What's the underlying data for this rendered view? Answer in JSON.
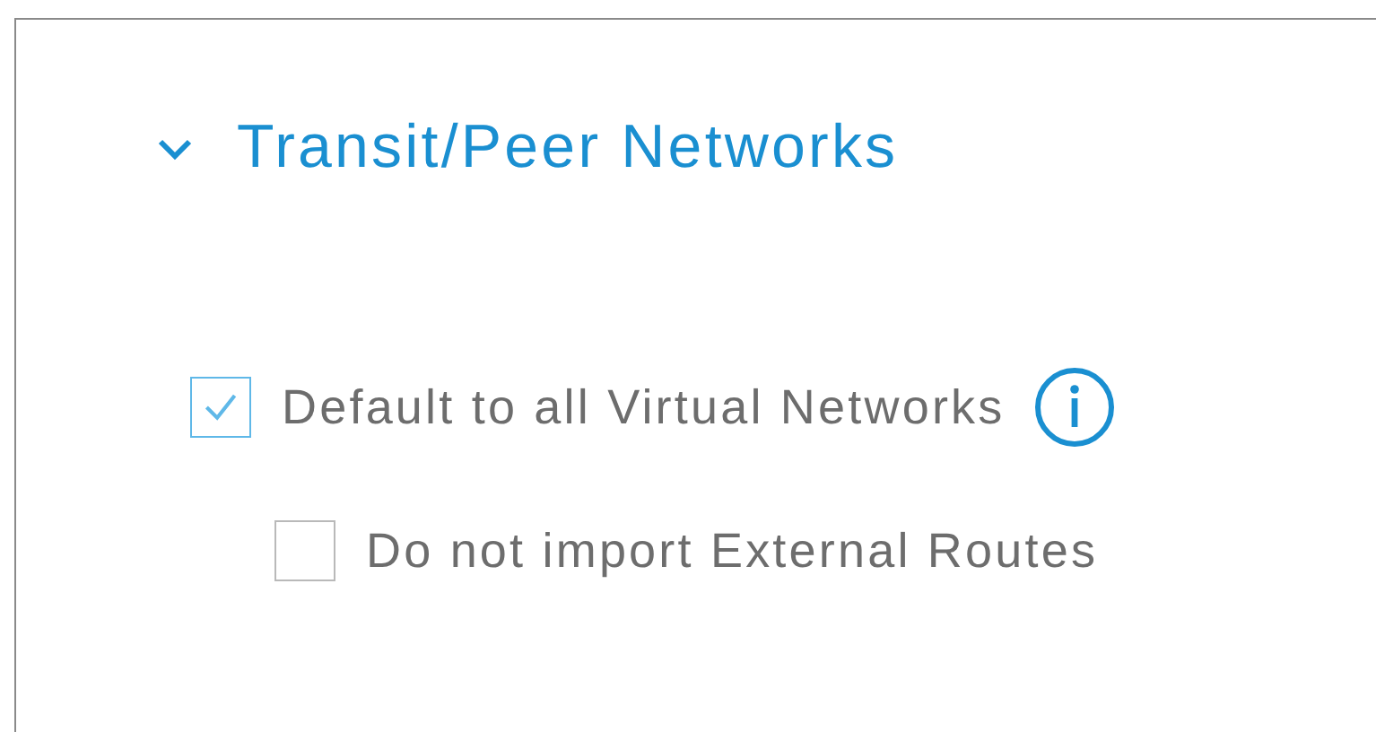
{
  "section": {
    "title": "Transit/Peer Networks",
    "expanded": true
  },
  "options": [
    {
      "label": "Default to all Virtual Networks",
      "checked": true,
      "info": true,
      "children": [
        {
          "label": "Do not import External Routes",
          "checked": false,
          "info": false
        }
      ]
    }
  ]
}
